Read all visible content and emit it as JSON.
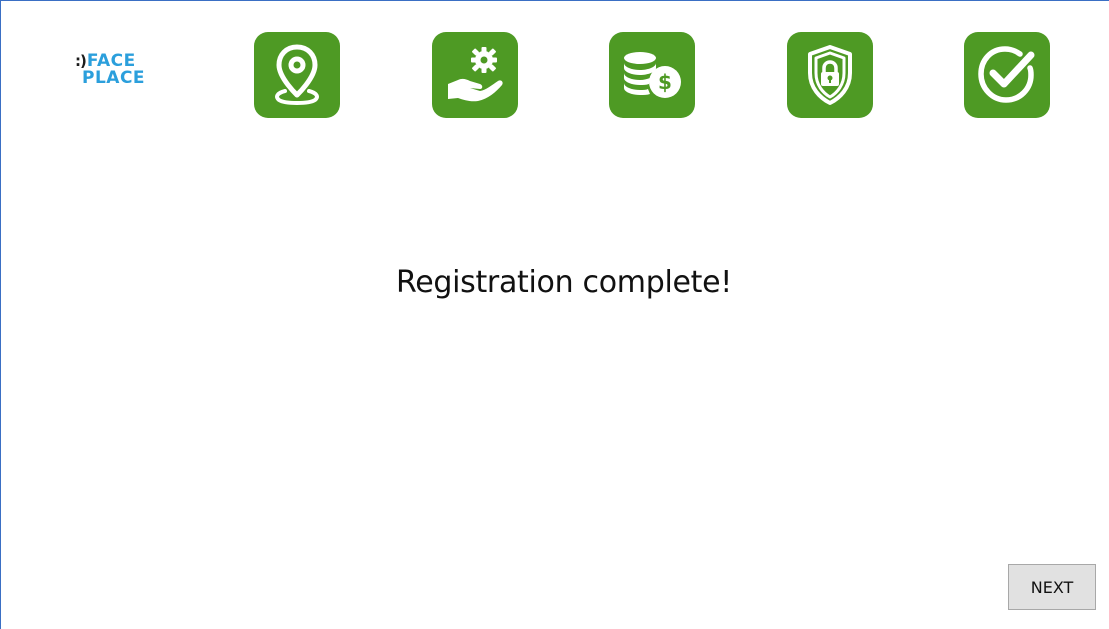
{
  "logo": {
    "mark": ":)",
    "line1": "FACE",
    "line2": "PLACE"
  },
  "steps": [
    {
      "icon": "location-pin-icon"
    },
    {
      "icon": "hand-gear-icon"
    },
    {
      "icon": "coins-dollar-icon"
    },
    {
      "icon": "shield-lock-icon"
    },
    {
      "icon": "check-circle-icon"
    }
  ],
  "colors": {
    "step_green": "#4e9a24",
    "logo_blue": "#2b9fdc",
    "button_gray": "#e1e1e1"
  },
  "main": {
    "message": "Registration complete!"
  },
  "footer": {
    "next_label": "NEXT"
  }
}
